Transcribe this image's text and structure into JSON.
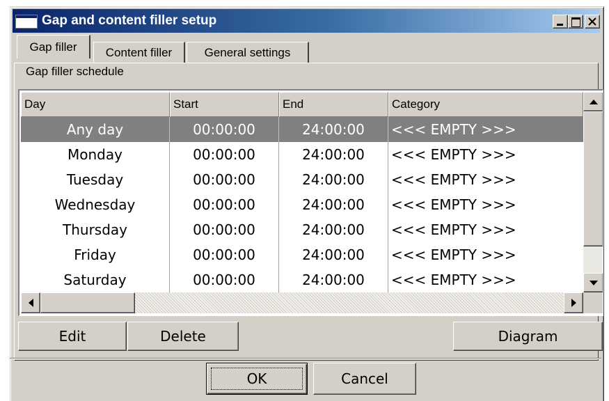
{
  "window": {
    "title": "Gap and content filler setup"
  },
  "tabs": [
    {
      "label": "Gap filler",
      "active": true
    },
    {
      "label": "Content filler",
      "active": false
    },
    {
      "label": "General settings",
      "active": false
    }
  ],
  "section": {
    "label": "Gap filler schedule"
  },
  "table": {
    "columns": [
      "Day",
      "Start",
      "End",
      "Category"
    ],
    "rows": [
      {
        "day": "Any day",
        "start": "00:00:00",
        "end": "24:00:00",
        "category": "<<< EMPTY >>>",
        "selected": true
      },
      {
        "day": "Monday",
        "start": "00:00:00",
        "end": "24:00:00",
        "category": "<<< EMPTY >>>"
      },
      {
        "day": "Tuesday",
        "start": "00:00:00",
        "end": "24:00:00",
        "category": "<<< EMPTY >>>"
      },
      {
        "day": "Wednesday",
        "start": "00:00:00",
        "end": "24:00:00",
        "category": "<<< EMPTY >>>"
      },
      {
        "day": "Thursday",
        "start": "00:00:00",
        "end": "24:00:00",
        "category": "<<< EMPTY >>>"
      },
      {
        "day": "Friday",
        "start": "00:00:00",
        "end": "24:00:00",
        "category": "<<< EMPTY >>>"
      },
      {
        "day": "Saturday",
        "start": "00:00:00",
        "end": "24:00:00",
        "category": "<<< EMPTY >>>"
      }
    ]
  },
  "buttons": {
    "edit": "Edit",
    "delete": "Delete",
    "diagram": "Diagram",
    "ok": "OK",
    "cancel": "Cancel"
  },
  "colors": {
    "titlebar_start": "#0a246a",
    "titlebar_end": "#a6caf0",
    "selected_row": "#808080",
    "face": "#d4d0c8"
  }
}
